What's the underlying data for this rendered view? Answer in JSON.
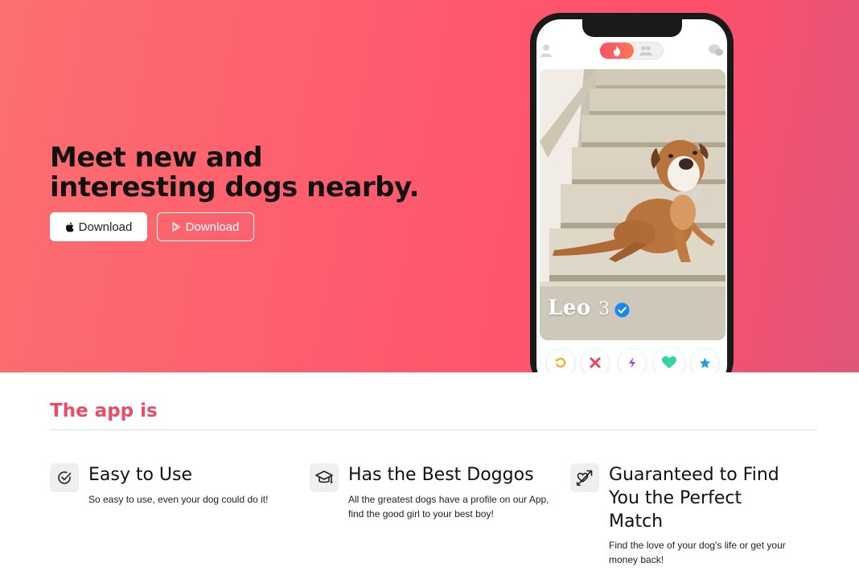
{
  "hero": {
    "title_line1": "Meet new and",
    "title_line2": "interesting dogs nearby.",
    "apple_button_label": "Download",
    "play_button_label": "Download",
    "apple_icon": "apple-logo-icon",
    "play_icon": "play-store-icon"
  },
  "phone": {
    "card_name": "Leo",
    "card_age": "3",
    "verified_icon": "verified-badge-icon",
    "actions": [
      "rewind-icon",
      "nope-icon",
      "boost-icon",
      "like-icon",
      "super-like-icon"
    ],
    "colors": {
      "brand_gradient_start": "#fd5068",
      "brand_gradient_end": "#ff7854",
      "verified": "#1786f8"
    }
  },
  "section": {
    "title": "The app is"
  },
  "features": [
    {
      "icon": "check-circle-icon",
      "title": "Easy to Use",
      "description": "So easy to use, even your dog could do it!"
    },
    {
      "icon": "graduation-cap-icon",
      "title": "Has the Best Doggos",
      "description": "All the greatest dogs have a profile on our App, find the good girl to your best boy!"
    },
    {
      "icon": "cupid-arrow-icon",
      "title_line1": "Guaranteed to Find",
      "title_line2": "You the Perfect",
      "title_line3": "Match",
      "description": "Find the love of your dog's life or get your money back!"
    }
  ],
  "colors": {
    "hero_bg": "#fd5b6e",
    "accent_text": "#ea4c64"
  }
}
